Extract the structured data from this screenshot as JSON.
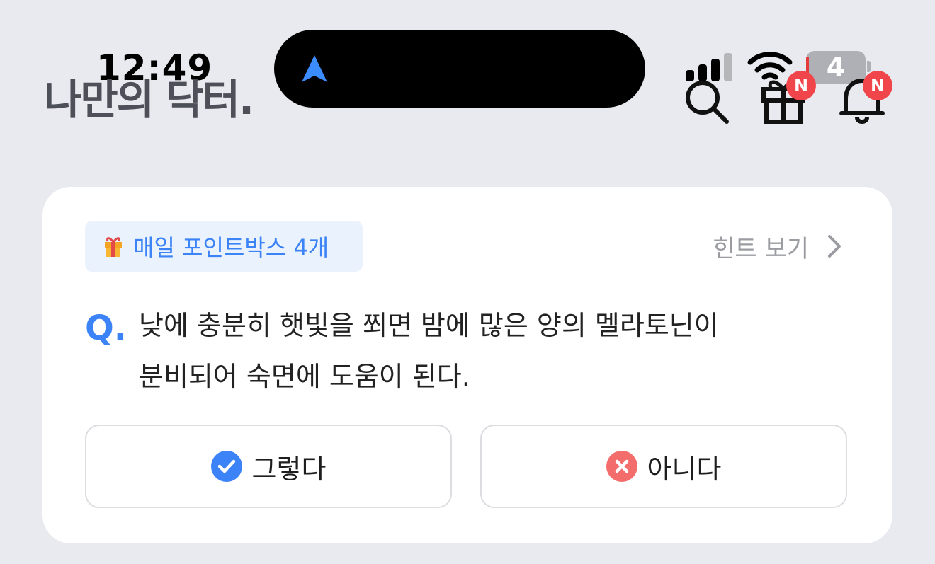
{
  "status_bar": {
    "time": "12:49",
    "battery_level": "4"
  },
  "header": {
    "logo_text": "나만의 닥터.",
    "gift_badge": "N",
    "bell_badge": "N"
  },
  "quiz": {
    "points_pill": "매일 포인트박스 4개",
    "hint_label": "힌트 보기",
    "q_mark": "Q.",
    "question_line1": "낮에 충분히 햇빛을 쬐면 밤에 많은 양의 멜라토닌이",
    "question_line2": "분비되어 숙면에 도움이 된다.",
    "yes_label": "그렇다",
    "no_label": "아니다"
  },
  "colors": {
    "accent_blue": "#3b83f6",
    "badge_red": "#f0464b",
    "no_red": "#f46d6d",
    "background": "#e9eaef"
  },
  "icons": [
    "navigation-arrow-icon",
    "cellular-signal-icon",
    "wifi-icon",
    "battery-icon",
    "search-icon",
    "gift-icon",
    "bell-icon",
    "gift-box-emoji-icon",
    "chevron-right-icon",
    "check-circle-icon",
    "x-circle-icon"
  ]
}
